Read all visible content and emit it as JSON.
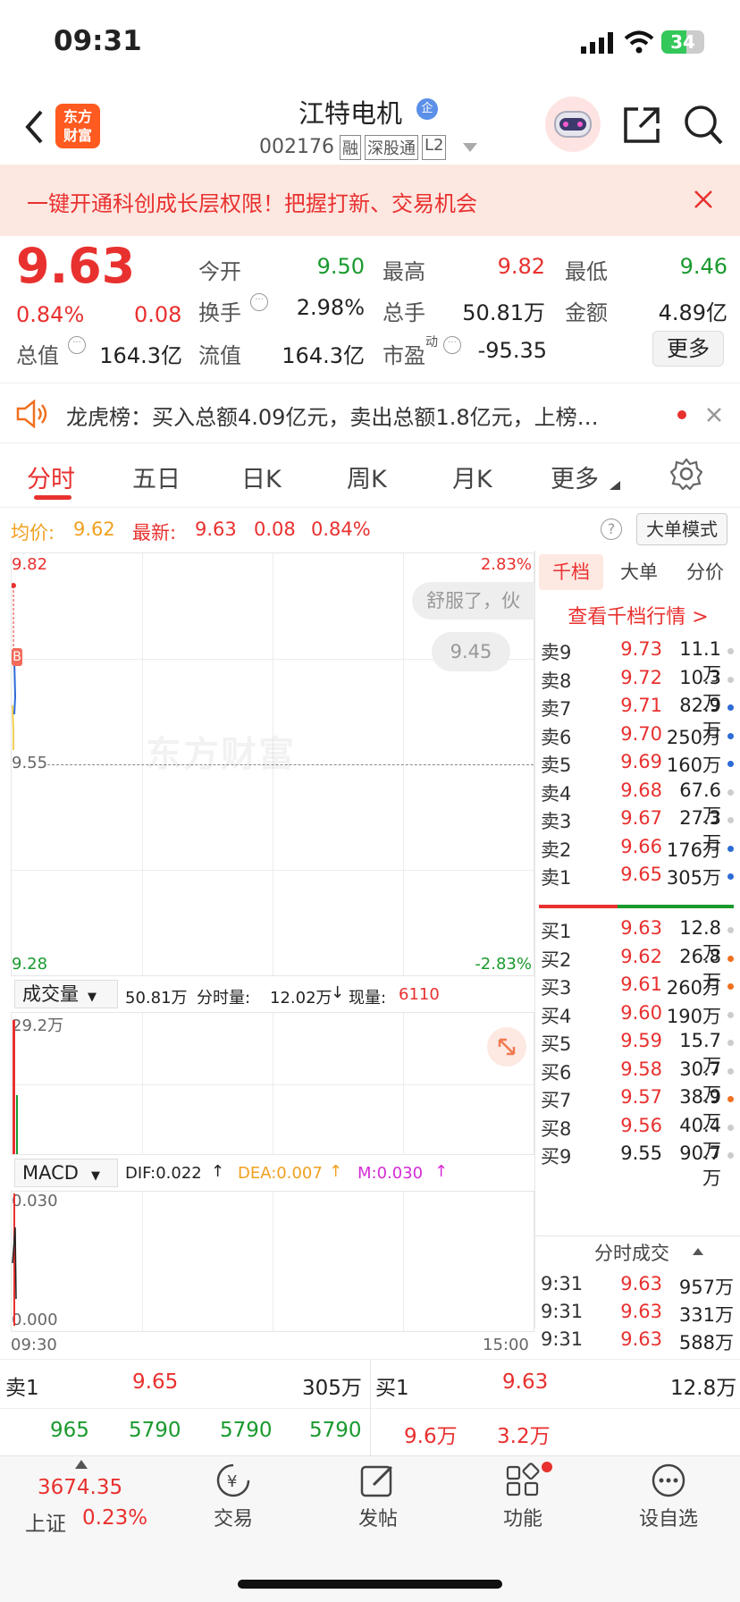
{
  "status": {
    "time": "09:31",
    "battery": "34"
  },
  "header": {
    "logo_line1": "东方",
    "logo_line2": "财富",
    "stock_name": "江特电机",
    "enterprise_badge": "企",
    "stock_code": "002176",
    "tags": [
      "融",
      "深股通",
      "L2"
    ]
  },
  "banner": {
    "text": "一键开通科创成长层权限！把握打新、交易机会"
  },
  "quote": {
    "price": "9.63",
    "change_pct": "0.84%",
    "change_amt": "0.08",
    "open_label": "今开",
    "open": "9.50",
    "high_label": "最高",
    "high": "9.82",
    "low_label": "最低",
    "low": "9.46",
    "turnover_label": "换手",
    "turnover": "2.98%",
    "volume_label": "总手",
    "volume": "50.81万",
    "amount_label": "金额",
    "amount": "4.89亿",
    "mktcap_label": "总值",
    "mktcap": "164.3亿",
    "float_label": "流值",
    "float": "164.3亿",
    "pe_label": "市盈",
    "pe_sup": "动",
    "pe": "-95.35",
    "more_button": "更多"
  },
  "dragon": {
    "text": "龙虎榜：买入总额4.09亿元，卖出总额1.8亿元，上榜…"
  },
  "tabs": [
    "分时",
    "五日",
    "日K",
    "周K",
    "月K",
    "更多"
  ],
  "avg": {
    "avg_label": "均价:",
    "avg_value": "9.62",
    "latest_label": "最新:",
    "latest_value": "9.63",
    "change": "0.08",
    "change_pct": "0.84%",
    "mode_button": "大单模式"
  },
  "chart": {
    "top_price": "9.82",
    "top_pct": "2.83%",
    "mid_price": "9.55",
    "bottom_price": "9.28",
    "bottom_pct": "-2.83%",
    "watermark": "东方财富",
    "comment_bubble": "舒服了，伙",
    "price_bubble": "9.45",
    "marker": "B"
  },
  "volume": {
    "label": "成交量",
    "total": "50.81万",
    "minute_label": "分时量:",
    "minute_value": "12.02万",
    "now_label": "现量:",
    "now_value": "6110",
    "max": "29.2万"
  },
  "macd": {
    "label": "MACD",
    "dif": "DIF:0.022",
    "dea": "DEA:0.007",
    "m": "M:0.030",
    "top": "0.030",
    "bottom": "0.000",
    "time_start": "09:30",
    "time_end": "15:00"
  },
  "right_tabs": [
    "千档",
    "大单",
    "分价"
  ],
  "depth_link": "查看千档行情 >",
  "asks": [
    {
      "label": "卖9",
      "price": "9.73",
      "vol": "11.1万",
      "dot": "#cccccc"
    },
    {
      "label": "卖8",
      "price": "9.72",
      "vol": "10.3万",
      "dot": "#cccccc"
    },
    {
      "label": "卖7",
      "price": "9.71",
      "vol": "82.9万",
      "dot": "#2d6bd6"
    },
    {
      "label": "卖6",
      "price": "9.70",
      "vol": "250万",
      "dot": "#2d6bd6"
    },
    {
      "label": "卖5",
      "price": "9.69",
      "vol": "160万",
      "dot": "#2d6bd6"
    },
    {
      "label": "卖4",
      "price": "9.68",
      "vol": "67.6万",
      "dot": "#cccccc"
    },
    {
      "label": "卖3",
      "price": "9.67",
      "vol": "27.3万",
      "dot": "#cccccc"
    },
    {
      "label": "卖2",
      "price": "9.66",
      "vol": "176万",
      "dot": "#2d6bd6"
    },
    {
      "label": "卖1",
      "price": "9.65",
      "vol": "305万",
      "dot": "#2d6bd6"
    }
  ],
  "bids": [
    {
      "label": "买1",
      "price": "9.63",
      "vol": "12.8万",
      "dot": "#cccccc"
    },
    {
      "label": "买2",
      "price": "9.62",
      "vol": "26.8万",
      "dot": "#f07020"
    },
    {
      "label": "买3",
      "price": "9.61",
      "vol": "260万",
      "dot": "#f07020"
    },
    {
      "label": "买4",
      "price": "9.60",
      "vol": "190万",
      "dot": "#cccccc"
    },
    {
      "label": "买5",
      "price": "9.59",
      "vol": "15.7万",
      "dot": "#cccccc"
    },
    {
      "label": "买6",
      "price": "9.58",
      "vol": "30.7万",
      "dot": "#cccccc"
    },
    {
      "label": "买7",
      "price": "9.57",
      "vol": "38.9万",
      "dot": "#f07020"
    },
    {
      "label": "买8",
      "price": "9.56",
      "vol": "40.4万",
      "dot": "#cccccc"
    },
    {
      "label": "买9",
      "price": "9.55",
      "vol": "90.7万",
      "dot": "#cccccc"
    }
  ],
  "trades_title": "分时成交",
  "trades": [
    {
      "time": "9:31",
      "price": "9.63",
      "vol": "957万"
    },
    {
      "time": "9:31",
      "price": "9.63",
      "vol": "331万"
    },
    {
      "time": "9:31",
      "price": "9.63",
      "vol": "588万"
    }
  ],
  "bottom": {
    "sell_label": "卖1",
    "sell_price": "9.65",
    "sell_vol": "305万",
    "buy_label": "买1",
    "buy_price": "9.63",
    "buy_vol": "12.8万",
    "sell_items": [
      "965",
      "5790",
      "5790",
      "5790"
    ],
    "buy_items": [
      "9.6万",
      "3.2万"
    ]
  },
  "tabbar": {
    "index_value": "3674.35",
    "index_name": "上证",
    "index_pct": "0.23%",
    "items": [
      "交易",
      "发帖",
      "功能",
      "设自选"
    ]
  }
}
